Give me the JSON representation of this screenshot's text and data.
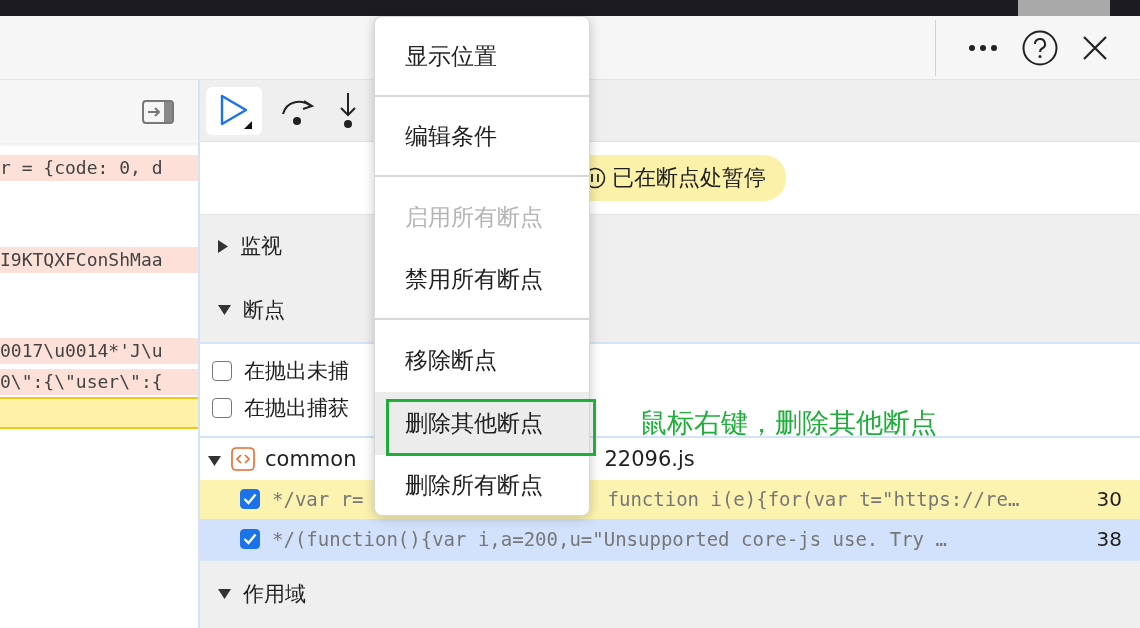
{
  "source_panel": {
    "code_lines": [
      {
        "kind": "error",
        "text": "r = {code: 0, d"
      },
      {
        "kind": "blank"
      },
      {
        "kind": "blank"
      },
      {
        "kind": "error",
        "text": "I9KTQXFConShMaa"
      },
      {
        "kind": "blank"
      },
      {
        "kind": "blank"
      },
      {
        "kind": "error",
        "text": "0017\\u0014*'J\\u"
      },
      {
        "kind": "error",
        "text": "0\\\":{\\\"user\\\":{"
      },
      {
        "kind": "current"
      }
    ]
  },
  "debugger": {
    "paused_message": "已在断点处暂停",
    "sections": [
      {
        "label": "监视",
        "expanded": false
      },
      {
        "label": "断点",
        "expanded": true
      }
    ],
    "exception_options": [
      {
        "label": "在抛出未捕",
        "checked": false
      },
      {
        "label": "在抛出捕获",
        "checked": false
      }
    ],
    "file": {
      "name_start": "common",
      "name_end": "22096.js",
      "expanded": true
    },
    "breakpoints": [
      {
        "code": "*/var r=",
        "code_end": "function i(e){for(var t=\"https://re…",
        "line": "30",
        "checked": true,
        "paused": true,
        "selected": false
      },
      {
        "code": "*/(function(){var i,a=200,u=\"Unsupported core-js use. Try …",
        "line": "38",
        "checked": true,
        "paused": false,
        "selected": true
      }
    ],
    "scope_section": {
      "label": "作用域",
      "expanded": true
    }
  },
  "context_menu": {
    "groups": [
      [
        {
          "label": "显示位置",
          "disabled": false,
          "selected": false
        }
      ],
      [
        {
          "label": "编辑条件",
          "disabled": false,
          "selected": false
        }
      ],
      [
        {
          "label": "启用所有断点",
          "disabled": true,
          "selected": false
        },
        {
          "label": "禁用所有断点",
          "disabled": false,
          "selected": false
        }
      ],
      [
        {
          "label": "移除断点",
          "disabled": false,
          "selected": false
        },
        {
          "label": "删除其他断点",
          "disabled": false,
          "selected": true
        },
        {
          "label": "删除所有断点",
          "disabled": false,
          "selected": false
        }
      ]
    ]
  },
  "annotation": {
    "text": "鼠标右键，删除其他断点"
  }
}
